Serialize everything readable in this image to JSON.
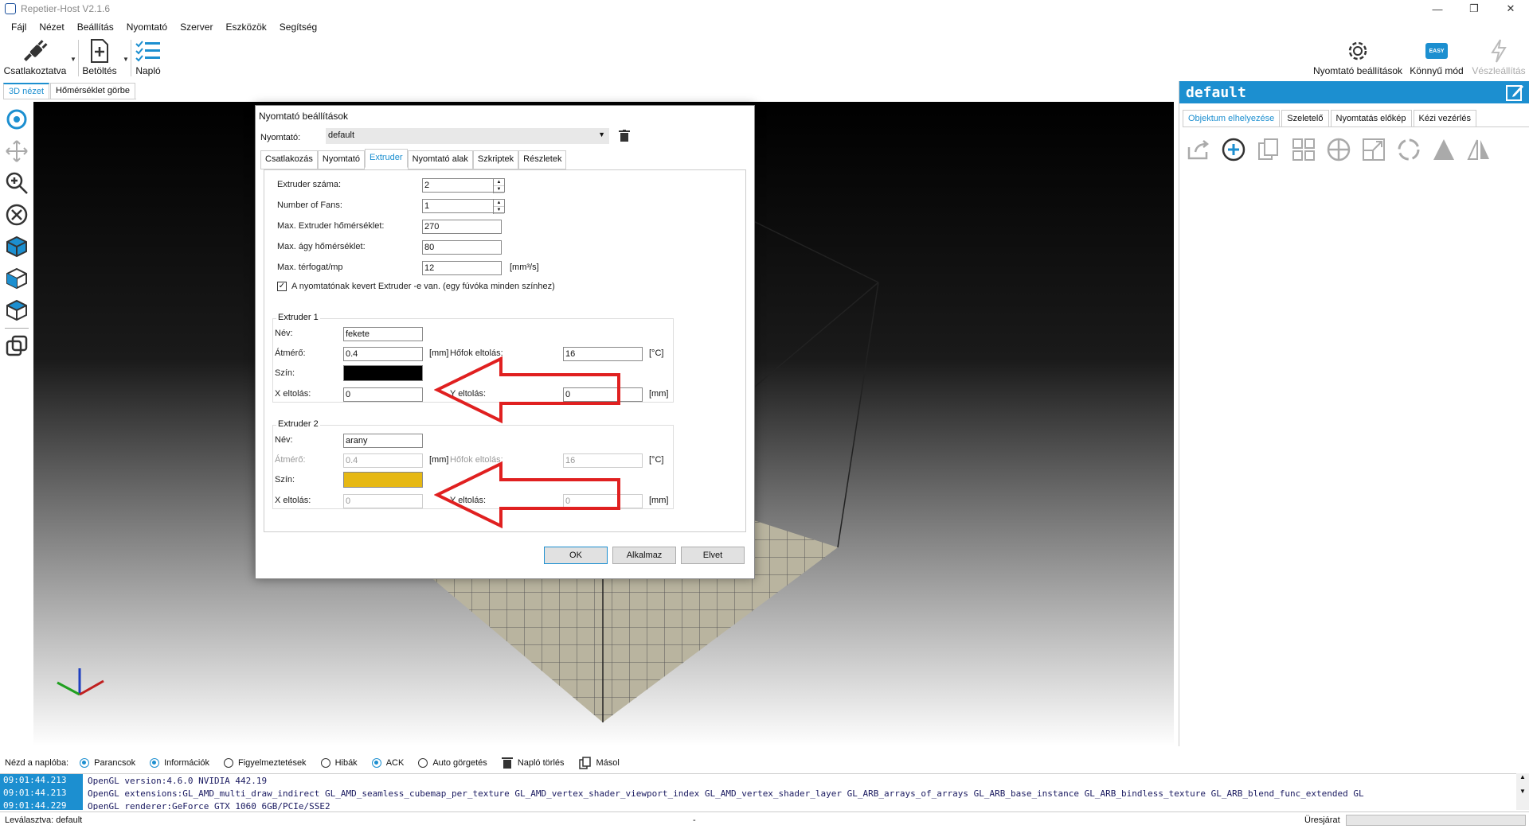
{
  "window": {
    "title": "Repetier-Host V2.1.6",
    "controls": [
      "—",
      "❐",
      "✕"
    ]
  },
  "menu": [
    "Fájl",
    "Nézet",
    "Beállítás",
    "Nyomtató",
    "Szerver",
    "Eszközök",
    "Segítség"
  ],
  "toolbar": {
    "connect_label": "Csatlakoztatva",
    "load_label": "Betöltés",
    "log_label": "Napló",
    "printer_settings_label": "Nyomtató beállítások",
    "easy_mode_label": "Könnyű mód",
    "easy_badge": "EASY",
    "emergency_label": "Vészleállítás"
  },
  "view_tabs": [
    "3D nézet",
    "Hőmérséklet görbe"
  ],
  "right_panel": {
    "header": "default",
    "tabs": [
      "Objektum elhelyezése",
      "Szeletelő",
      "Nyomtatás előkép",
      "Kézi vezérlés"
    ]
  },
  "dialog": {
    "title": "Nyomtató beállítások",
    "printer_label": "Nyomtató:",
    "printer_value": "default",
    "tabs": [
      "Csatlakozás",
      "Nyomtató",
      "Extruder",
      "Nyomtató alak",
      "Szkriptek",
      "Részletek"
    ],
    "fields": {
      "extruder_count_label": "Extruder száma:",
      "extruder_count": "2",
      "fans_label": "Number of Fans:",
      "fans": "1",
      "max_ext_temp_label": "Max. Extruder hőmérséklet:",
      "max_ext_temp": "270",
      "max_bed_temp_label": "Max. ágy hőmérséklet:",
      "max_bed_temp": "80",
      "max_volume_label": "Max. térfogat/mp",
      "max_volume": "12",
      "max_volume_unit": "[mm³/s]",
      "mixing_label": "A nyomtatónak kevert Extruder -e van. (egy fúvóka minden színhez)"
    },
    "extruder1": {
      "title": "Extruder 1",
      "name_label": "Név:",
      "name": "fekete",
      "diam_label": "Átmérő:",
      "diam": "0.4",
      "diam_unit": "[mm]",
      "temp_offset_label": "Hőfok eltolás:",
      "temp_offset": "16",
      "temp_unit": "[°C]",
      "color_label": "Szín:",
      "color": "#000000",
      "x_label": "X eltolás:",
      "x": "0",
      "y_label": "Y eltolás:",
      "y": "0",
      "xy_unit": "[mm]"
    },
    "extruder2": {
      "title": "Extruder 2",
      "name_label": "Név:",
      "name": "arany",
      "diam_label": "Átmérő:",
      "diam": "0.4",
      "diam_unit": "[mm]",
      "temp_offset_label": "Hőfok eltolás:",
      "temp_offset": "16",
      "temp_unit": "[°C]",
      "color_label": "Szín:",
      "color": "#e6b813",
      "x_label": "X eltolás:",
      "x": "0",
      "y_label": "Y eltolás:",
      "y": "0",
      "xy_unit": "[mm]"
    },
    "buttons": {
      "ok": "OK",
      "apply": "Alkalmaz",
      "discard": "Elvet"
    }
  },
  "log_options": {
    "label": "Nézd a naplóba:",
    "items": [
      {
        "label": "Parancsok",
        "on": true
      },
      {
        "label": "Információk",
        "on": true
      },
      {
        "label": "Figyelmeztetések",
        "on": false
      },
      {
        "label": "Hibák",
        "on": false
      },
      {
        "label": "ACK",
        "on": true
      },
      {
        "label": "Auto görgetés",
        "on": false
      }
    ],
    "clear_label": "Napló törlés",
    "copy_label": "Másol"
  },
  "log_lines": [
    {
      "ts": "09:01:44.213",
      "msg": "OpenGL version:4.6.0 NVIDIA 442.19"
    },
    {
      "ts": "09:01:44.213",
      "msg": "OpenGL extensions:GL_AMD_multi_draw_indirect GL_AMD_seamless_cubemap_per_texture GL_AMD_vertex_shader_viewport_index GL_AMD_vertex_shader_layer GL_ARB_arrays_of_arrays GL_ARB_base_instance GL_ARB_bindless_texture GL_ARB_blend_func_extended GL"
    },
    {
      "ts": "09:01:44.229",
      "msg": "OpenGL renderer:GeForce GTX 1060 6GB/PCIe/SSE2"
    }
  ],
  "status": {
    "left": "Leválasztva: default",
    "middle": "-",
    "right": "Üresjárat"
  },
  "colors": {
    "accent": "#1c8fd0",
    "arrow": "#e02020",
    "bed": "#b9b49f"
  }
}
